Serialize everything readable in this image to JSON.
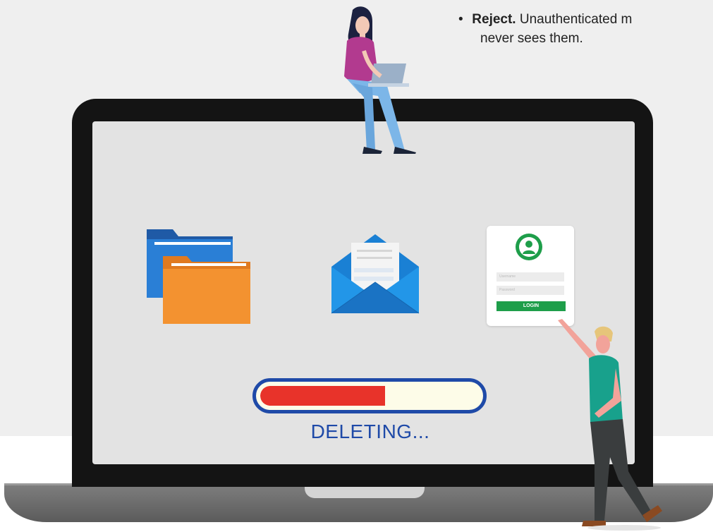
{
  "note": {
    "bullet": "•",
    "title": "Reject.",
    "text": "Unauthenticated m",
    "continuation": "never sees them."
  },
  "login_card": {
    "username_placeholder": "Username",
    "password_placeholder": "Password",
    "button_label": "LOGIN"
  },
  "progress": {
    "label": "DELETING...",
    "fraction": 0.57,
    "fill_color": "#e8332a",
    "border_color": "#1f4aa8"
  },
  "icons": [
    "folder-icon",
    "email-envelope-icon",
    "user-avatar-icon"
  ],
  "colors": {
    "folder_back": "#1f6fc4",
    "folder_front": "#f39230",
    "envelope": "#1a80d4",
    "login_green": "#1e9e4a"
  }
}
